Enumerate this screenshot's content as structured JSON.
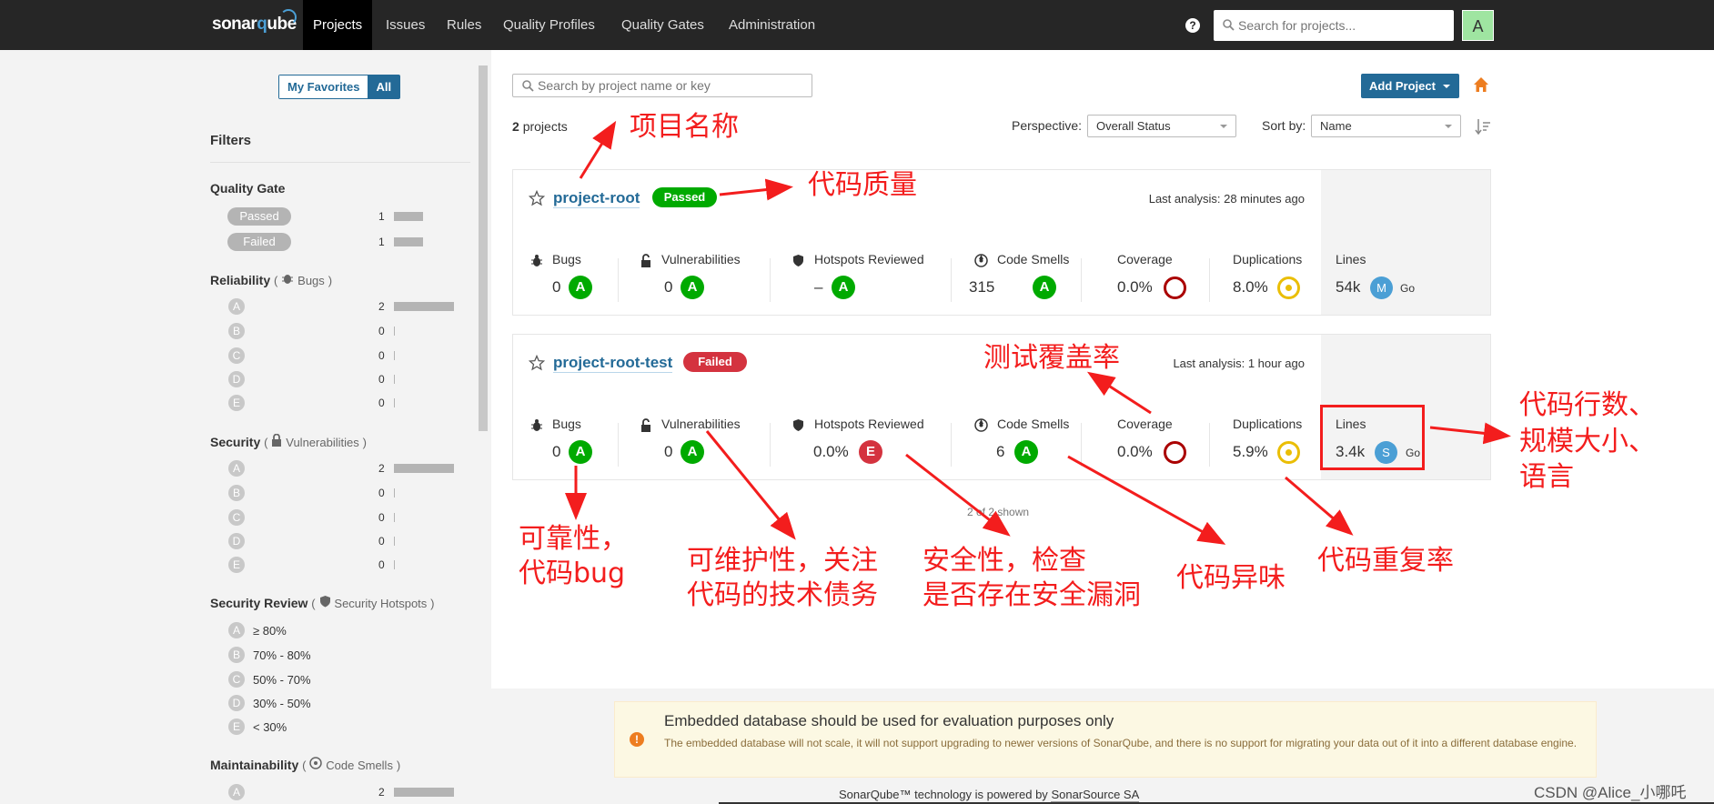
{
  "nav": {
    "logo_prefix": "sonar",
    "logo_q": "q",
    "logo_suffix": "ube",
    "links": [
      "Projects",
      "Issues",
      "Rules",
      "Quality Profiles",
      "Quality Gates",
      "Administration"
    ],
    "help": "?",
    "search_placeholder": "Search for projects...",
    "avatar": "A"
  },
  "sidebar": {
    "my_favorites": "My Favorites",
    "all": "All",
    "filters_title": "Filters",
    "quality_gate": {
      "title": "Quality Gate",
      "items": [
        {
          "label": "Passed",
          "count": "1"
        },
        {
          "label": "Failed",
          "count": "1"
        }
      ]
    },
    "reliability": {
      "title": "Reliability",
      "paren_open": "(",
      "sub": "Bugs",
      "paren_close": ")",
      "items": [
        {
          "grade": "A",
          "count": "2"
        },
        {
          "grade": "B",
          "count": "0"
        },
        {
          "grade": "C",
          "count": "0"
        },
        {
          "grade": "D",
          "count": "0"
        },
        {
          "grade": "E",
          "count": "0"
        }
      ]
    },
    "security": {
      "title": "Security",
      "paren_open": "(",
      "sub": "Vulnerabilities",
      "paren_close": ")",
      "items": [
        {
          "grade": "A",
          "count": "2"
        },
        {
          "grade": "B",
          "count": "0"
        },
        {
          "grade": "C",
          "count": "0"
        },
        {
          "grade": "D",
          "count": "0"
        },
        {
          "grade": "E",
          "count": "0"
        }
      ]
    },
    "security_review": {
      "title": "Security Review",
      "paren_open": "(",
      "sub": "Security Hotspots",
      "paren_close": ")",
      "items": [
        {
          "grade": "A",
          "range": "≥ 80%"
        },
        {
          "grade": "B",
          "range": "70% - 80%"
        },
        {
          "grade": "C",
          "range": "50% - 70%"
        },
        {
          "grade": "D",
          "range": "30% - 50%"
        },
        {
          "grade": "E",
          "range": "< 30%"
        }
      ]
    },
    "maintainability": {
      "title": "Maintainability",
      "paren_open": "(",
      "sub": "Code Smells",
      "paren_close": ")",
      "items": [
        {
          "grade": "A",
          "count": "2"
        }
      ]
    }
  },
  "main": {
    "search_placeholder": "Search by project name or key",
    "add_project": "Add Project",
    "count_num": "2",
    "count_label": "projects",
    "perspective_label": "Perspective:",
    "perspective_value": "Overall Status",
    "sortby_label": "Sort by:",
    "sortby_value": "Name",
    "shown": "2 of 2 shown",
    "colors": {
      "rating_a": "#00aa00",
      "rating_e": "#d4333f",
      "passed": "#00aa00",
      "failed": "#d4333f",
      "link": "#236a97"
    },
    "projects": [
      {
        "name": "project-root",
        "status": "Passed",
        "last_analysis": "Last analysis: 28 minutes ago",
        "metrics": {
          "bugs_label": "Bugs",
          "bugs_value": "0",
          "bugs_rating": "A",
          "vuln_label": "Vulnerabilities",
          "vuln_value": "0",
          "vuln_rating": "A",
          "hotspots_label": "Hotspots Reviewed",
          "hotspots_value": "–",
          "hotspots_rating": "A",
          "smells_label": "Code Smells",
          "smells_value": "315",
          "smells_rating": "A",
          "coverage_label": "Coverage",
          "coverage_value": "0.0%",
          "dup_label": "Duplications",
          "dup_value": "8.0%",
          "lines_label": "Lines",
          "lines_value": "54k",
          "lang_size": "M",
          "lang": "Go"
        }
      },
      {
        "name": "project-root-test",
        "status": "Failed",
        "last_analysis": "Last analysis: 1 hour ago",
        "metrics": {
          "bugs_label": "Bugs",
          "bugs_value": "0",
          "bugs_rating": "A",
          "vuln_label": "Vulnerabilities",
          "vuln_value": "0",
          "vuln_rating": "A",
          "hotspots_label": "Hotspots Reviewed",
          "hotspots_value": "0.0%",
          "hotspots_rating": "E",
          "smells_label": "Code Smells",
          "smells_value": "6",
          "smells_rating": "A",
          "coverage_label": "Coverage",
          "coverage_value": "0.0%",
          "dup_label": "Duplications",
          "dup_value": "5.9%",
          "lines_label": "Lines",
          "lines_value": "3.4k",
          "lang_size": "S",
          "lang": "Go"
        }
      }
    ]
  },
  "footer": {
    "warning_title": "Embedded database should be used for evaluation purposes only",
    "warning_text": "The embedded database will not scale, it will not support upgrading to newer versions of SonarQube, and there is no support for migrating your data out of it into a different database engine.",
    "warning_icon": "!",
    "powered_prefix": "SonarQube™ technology is powered by",
    "powered_link": "SonarSource SA",
    "watermark": "CSDN @Alice_小哪吒"
  },
  "annotations": {
    "project_name": "项目名称",
    "code_quality": "代码质量",
    "test_coverage": "测试覆盖率",
    "lines_1": "代码行数、",
    "lines_2": "规模大小、",
    "lines_3": "语言",
    "reliability_1": "可靠性，",
    "reliability_2": "代码bug",
    "maintain_1": "可维护性，关注",
    "maintain_2": "代码的技术债务",
    "security_1": "安全性，检查",
    "security_2": "是否存在安全漏洞",
    "smells": "代码异味",
    "duplication": "代码重复率"
  }
}
